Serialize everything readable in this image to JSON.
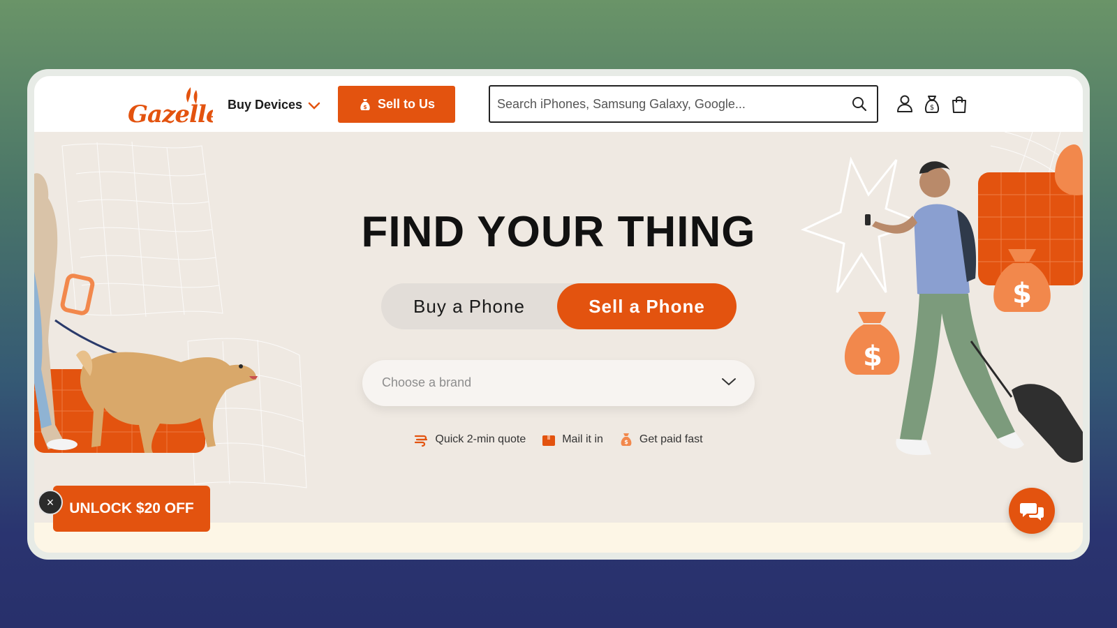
{
  "header": {
    "logo_text": "Gazelle",
    "buy_devices_label": "Buy Devices",
    "sell_button_label": "Sell to Us",
    "search_placeholder": "Search iPhones, Samsung Galaxy, Google...",
    "icons": [
      "account-icon",
      "money-bag-icon",
      "shopping-bag-icon"
    ]
  },
  "hero": {
    "title": "FIND YOUR THING",
    "toggle": {
      "buy_label": "Buy a Phone",
      "sell_label": "Sell a Phone",
      "active": "sell"
    },
    "brand_select_placeholder": "Choose a brand",
    "features": [
      {
        "icon": "speed-icon",
        "label": "Quick 2-min quote"
      },
      {
        "icon": "box-icon",
        "label": "Mail it in"
      },
      {
        "icon": "money-bag-icon",
        "label": "Get paid fast"
      }
    ]
  },
  "promo": {
    "label": "UNLOCK $20 OFF",
    "close_label": "×"
  },
  "colors": {
    "accent": "#e3530f",
    "hero_bg": "#efe9e2",
    "strip_bg": "#fdf6e6",
    "text": "#111111"
  }
}
